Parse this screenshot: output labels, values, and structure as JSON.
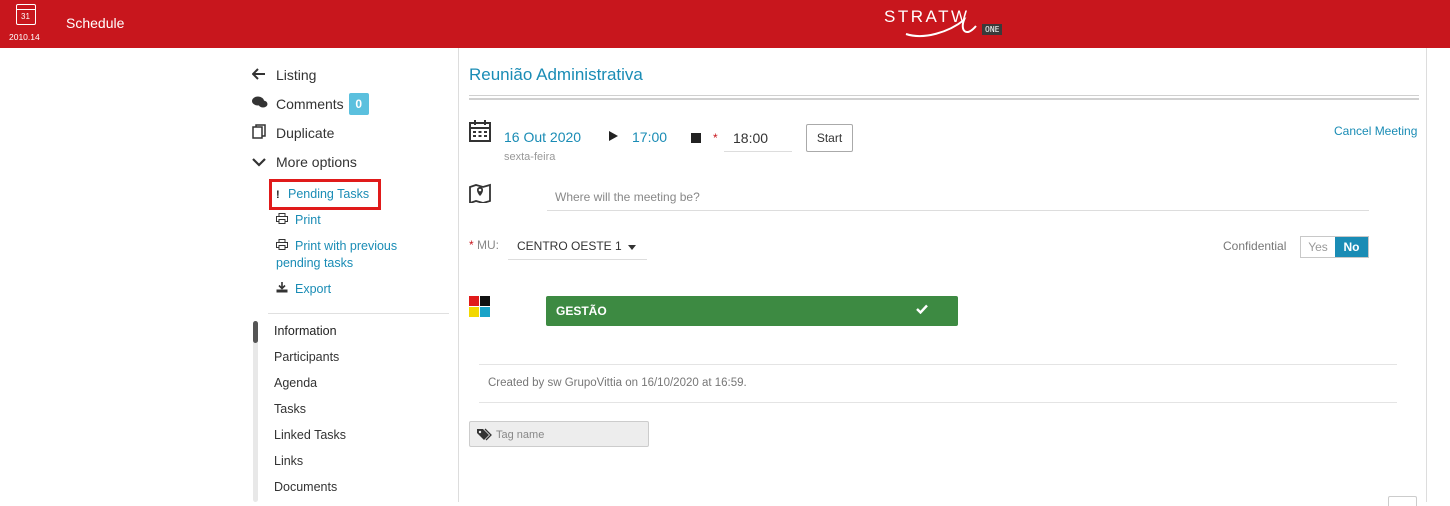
{
  "topbar": {
    "calendar_day": "31",
    "version": "2010.14",
    "app_title": "Schedule",
    "brand": "STRATW",
    "brand_badge": "ONE",
    "bg_color": "#c8161d"
  },
  "left_menu": {
    "items": [
      {
        "label": "Listing",
        "icon": "arrow-left-icon"
      },
      {
        "label": "Comments",
        "icon": "comments-icon",
        "count": "0"
      },
      {
        "label": "Duplicate",
        "icon": "copy-icon"
      },
      {
        "label": "More options",
        "icon": "chevron-down-icon"
      }
    ],
    "sub_items": [
      {
        "label": "Pending Tasks",
        "icon": "exclamation-icon",
        "icon_glyph": "!"
      },
      {
        "label": "Print",
        "icon": "print-icon"
      },
      {
        "label": "Print with previous pending tasks",
        "label_line1": "Print with previous",
        "label_line2": "pending tasks",
        "icon": "print-icon"
      },
      {
        "label": "Export",
        "icon": "download-icon"
      }
    ],
    "sections": [
      "Information",
      "Participants",
      "Agenda",
      "Tasks",
      "Linked Tasks",
      "Links",
      "Documents"
    ]
  },
  "meeting": {
    "title": "Reunião Administrativa",
    "date": "16 Out 2020",
    "weekday": "sexta-feira",
    "start_time": "17:00",
    "end_time": "18:00",
    "start_button": "Start",
    "cancel_link": "Cancel Meeting",
    "location_placeholder": "Where will the meeting be?",
    "mu_label": "MU:",
    "mu_value": "CENTRO OESTE 1",
    "confidential_label": "Confidential",
    "confidential_yes": "Yes",
    "confidential_no": "No",
    "confidential_selected": "No",
    "category": "GESTÃO",
    "category_color": "#3d8a42",
    "created_info": "Created by sw GrupoVittia on 16/10/2020 at 16:59.",
    "tag_placeholder": "Tag name",
    "accent_color": "#1a8cb5"
  }
}
